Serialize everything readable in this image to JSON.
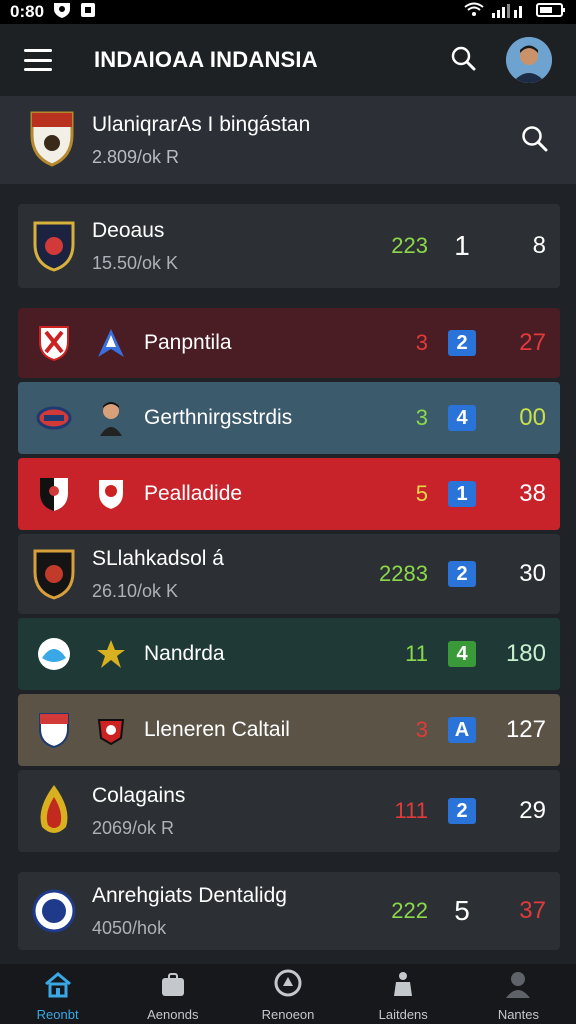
{
  "status": {
    "time": "0:80"
  },
  "header": {
    "title": "INDAIOAA INDANSIA"
  },
  "league": {
    "name": "UlaniqrarAs I bingástan",
    "sub": "2.809/ok R"
  },
  "rows": [
    {
      "name": "Deoaus",
      "sub": "15.50/ok K",
      "n1": "223",
      "n2": "1",
      "n3": "8",
      "bg": "#2c3035",
      "n1_color": "#8bd84a",
      "badge_bg": "transparent"
    },
    {
      "name": "Panpntila",
      "sub": "",
      "n1": "3",
      "n2": "2",
      "n3": "27",
      "bg": "#4a1c24",
      "n1_color": "#e23a3a",
      "badge_bg": "#2a73d9",
      "n3_color": "#e23a3a"
    },
    {
      "name": "Gerthnirgsstrdis",
      "sub": "",
      "n1": "3",
      "n2": "4",
      "n3": "00",
      "bg": "#3b5a6c",
      "n1_color": "#8bd84a",
      "badge_bg": "#2a73d9",
      "n3_color": "#c8e04a"
    },
    {
      "name": "Pealladide",
      "sub": "",
      "n1": "5",
      "n2": "1",
      "n3": "38",
      "bg": "#c8222a",
      "n1_color": "#e8d64a",
      "badge_bg": "#2a73d9",
      "n3_color": "#ffffff"
    },
    {
      "name": "SLlahkadsol á",
      "sub": "26.10/ok K",
      "n1": "2283",
      "n2": "2",
      "n3": "30",
      "bg": "#2c3035",
      "n1_color": "#8bd84a",
      "badge_bg": "#2a73d9",
      "n3_color": "#ffffff"
    },
    {
      "name": "Nandrda",
      "sub": "",
      "n1": "11",
      "n2": "4",
      "n3": "180",
      "bg": "#1f3a36",
      "n1_color": "#8bd84a",
      "badge_bg": "#3a9a3a",
      "n3_color": "#c8f0d0"
    },
    {
      "name": "Lleneren Caltail",
      "sub": "",
      "n1": "3",
      "n2": "A",
      "n3": "127",
      "bg": "#5a5346",
      "n1_color": "#e23a3a",
      "badge_bg": "#2a73d9",
      "n3_color": "#ffffff"
    },
    {
      "name": "Colagains",
      "sub": "2069/ok R",
      "n1": "111",
      "n2": "2",
      "n3": "29",
      "bg": "#2c3035",
      "n1_color": "#e23a3a",
      "badge_bg": "#2a73d9",
      "n3_color": "#ffffff"
    },
    {
      "name": "Anrehgiats Dentalidg",
      "sub": "4050/hok",
      "n1": "222",
      "n2": "5",
      "n3": "37",
      "bg": "#2c3035",
      "n1_color": "#8bd84a",
      "badge_bg": "transparent",
      "n3_color": "#e23a3a"
    }
  ],
  "nav": [
    {
      "label": "Reonbt",
      "icon": "home-icon"
    },
    {
      "label": "Aenonds",
      "icon": "bag-icon"
    },
    {
      "label": "Renoeon",
      "icon": "ball-icon"
    },
    {
      "label": "Laitdens",
      "icon": "player-icon"
    },
    {
      "label": "Nantes",
      "icon": "person-icon"
    }
  ],
  "colors": {
    "accent": "#3aa7e6",
    "background": "#1f2226"
  }
}
